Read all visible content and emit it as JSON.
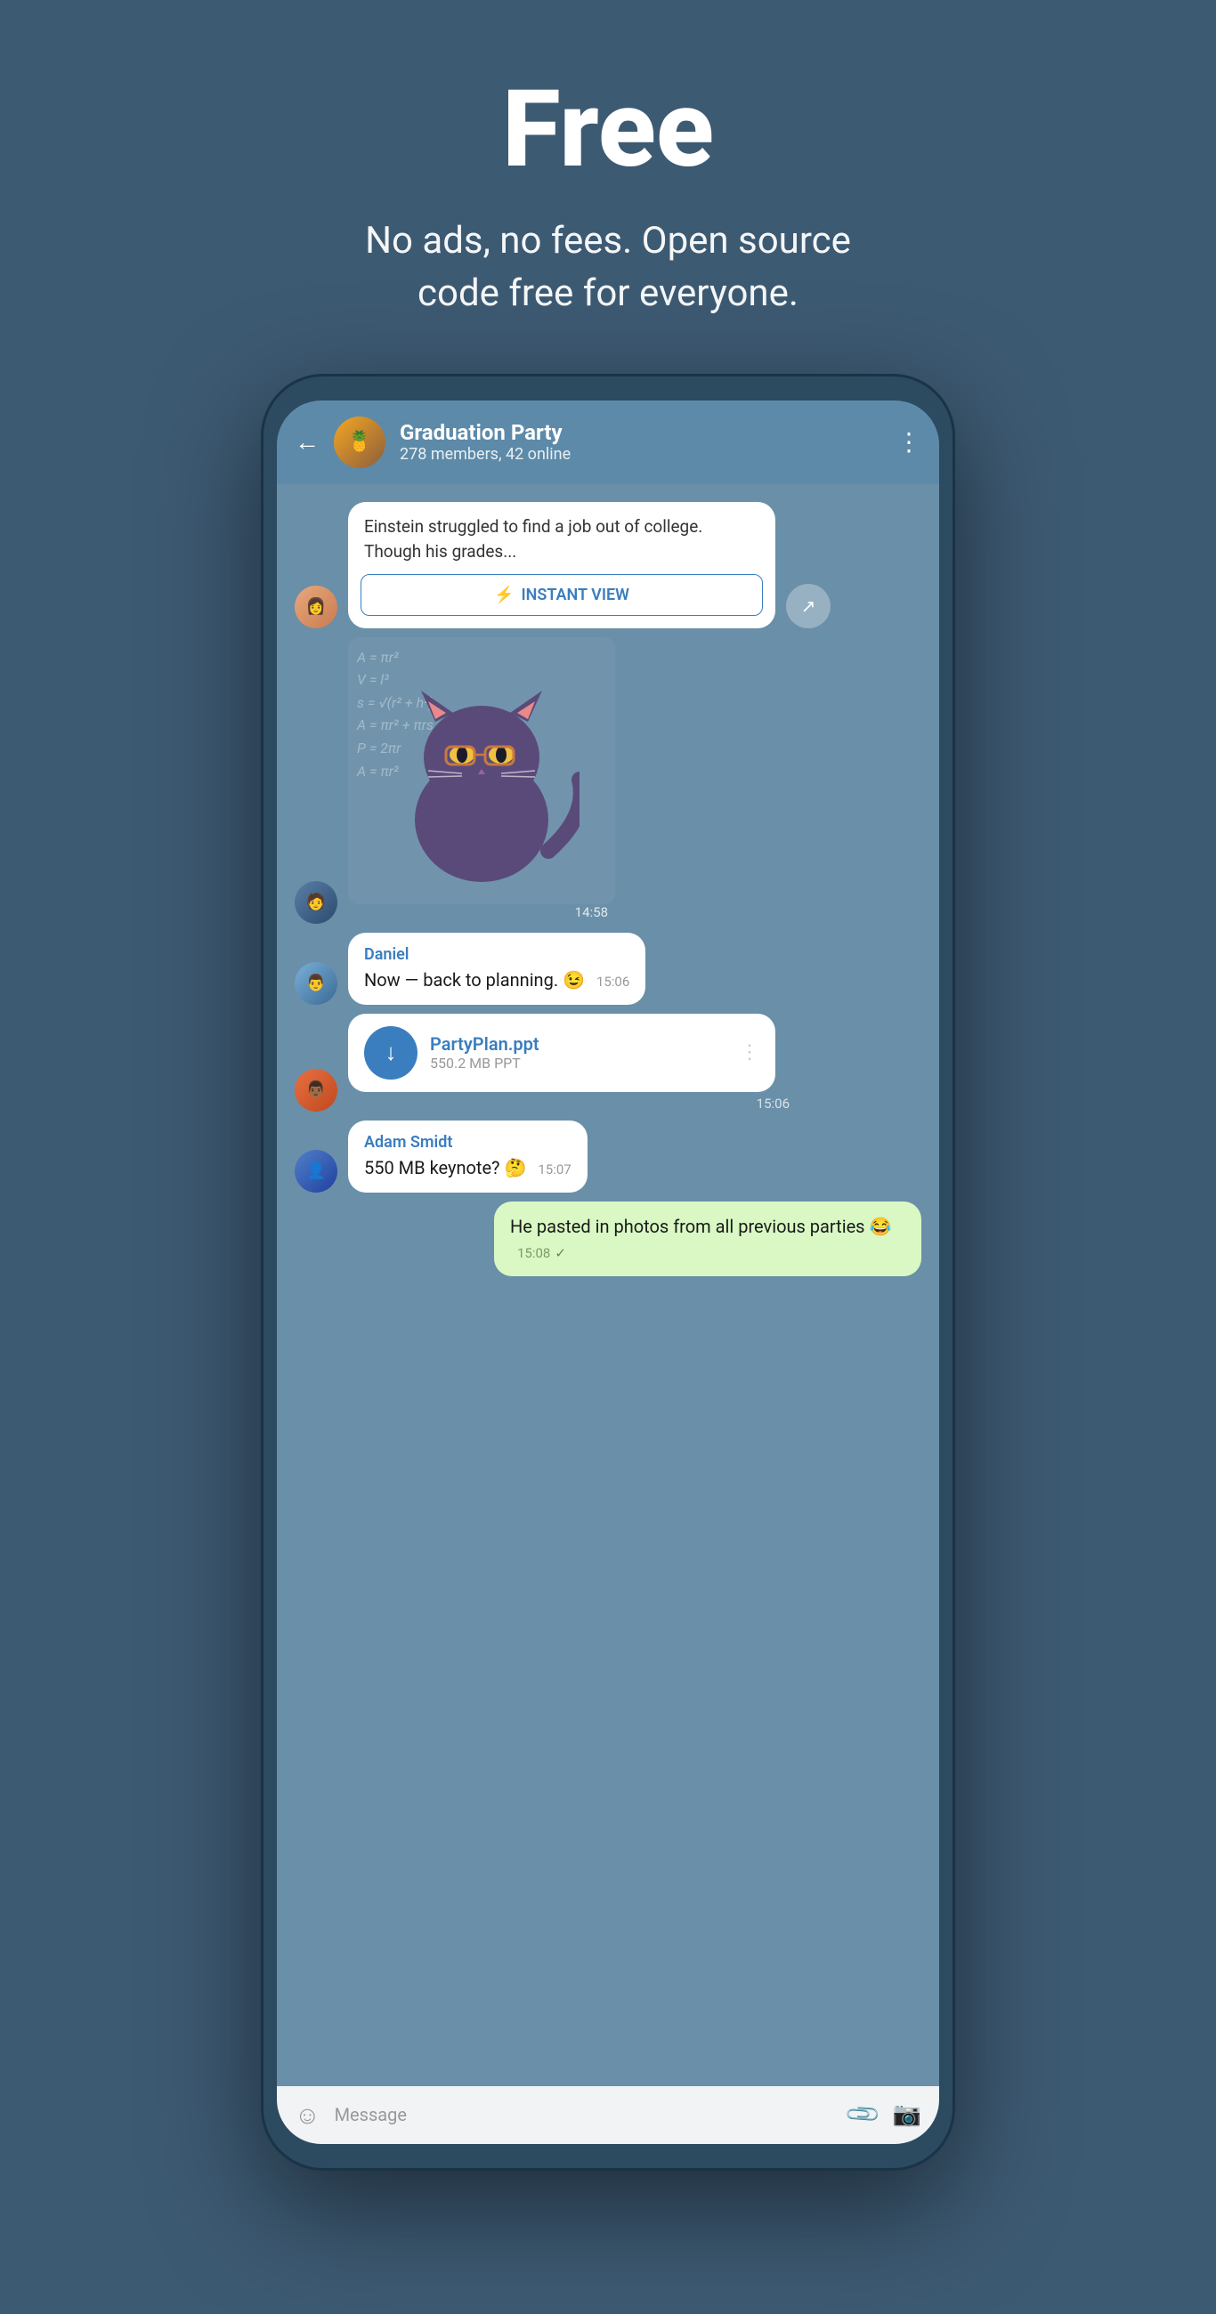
{
  "hero": {
    "title": "Free",
    "subtitle": "No ads, no fees. Open source\ncode free for everyone."
  },
  "chat": {
    "header": {
      "name": "Graduation Party",
      "members": "278 members, 42 online"
    },
    "messages": [
      {
        "id": "article-msg",
        "type": "article",
        "text": "Einstein struggled to find a job out of college. Though his grades...",
        "instant_view_label": "INSTANT VIEW"
      },
      {
        "id": "sticker-msg",
        "type": "sticker",
        "time": "14:58"
      },
      {
        "id": "daniel-msg",
        "type": "text",
        "sender": "Daniel",
        "text": "Now — back to planning. 😉",
        "time": "15:06"
      },
      {
        "id": "file-msg",
        "type": "file",
        "filename": "PartyPlan.ppt",
        "filesize": "550.2 MB PPT",
        "time": "15:06"
      },
      {
        "id": "adam-msg",
        "type": "text",
        "sender": "Adam Smidt",
        "text": "550 MB keynote? 🤔",
        "time": "15:07"
      },
      {
        "id": "my-msg",
        "type": "text",
        "own": true,
        "text": "He pasted in photos from all previous parties 😂",
        "time": "15:08",
        "checkmark": "✓"
      }
    ]
  },
  "input": {
    "placeholder": "Message"
  },
  "colors": {
    "bg": "#3d5a73",
    "header": "#5d8aa8",
    "chat_bg": "#6a8fa8",
    "sender_color": "#3a7ebf",
    "green_bubble": "#d9f8c4"
  }
}
